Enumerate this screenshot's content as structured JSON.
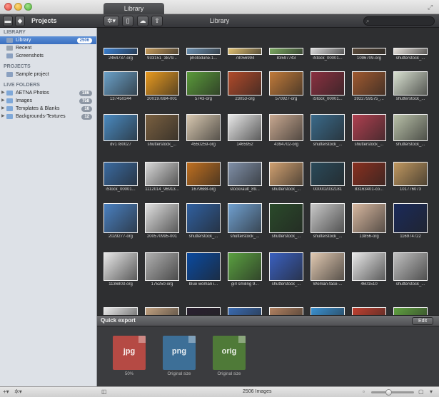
{
  "window": {
    "tab_title": "Library",
    "toolbar_title": "Library"
  },
  "toolbar": {
    "projects_label": "Projects",
    "search_placeholder": ""
  },
  "sidebar": {
    "library_header": "LIBRARY",
    "library_items": [
      {
        "label": "Library",
        "badge": "2506",
        "selected": true,
        "icon": "library-icon"
      },
      {
        "label": "Recent",
        "badge": "",
        "selected": false,
        "icon": "clock-icon"
      },
      {
        "label": "Screenshots",
        "badge": "",
        "selected": false,
        "icon": "screenshot-icon"
      }
    ],
    "projects_header": "PROJECTS",
    "project_items": [
      {
        "label": "Sample project",
        "icon": "project-icon"
      }
    ],
    "folders_header": "LIVE FOLDERS",
    "folder_items": [
      {
        "label": "AETNA Photos",
        "badge": "186"
      },
      {
        "label": "Images",
        "badge": "758"
      },
      {
        "label": "Templates & Blanks",
        "badge": "16"
      },
      {
        "label": "Backgrounds-Textures",
        "badge": "12"
      }
    ]
  },
  "grid": {
    "rows": [
      [
        "2464737-org",
        "933151_3879...",
        "photodune-1...",
        "78056994",
        "83597743",
        "iStock_00001...",
        "1096709-org",
        "shutterstock_..."
      ],
      [
        "137450344",
        "200197884-001",
        "5743-org",
        "23053-org",
        "570927-org",
        "iStock_00001...",
        "3922759575_...",
        "shutterstock_..."
      ],
      [
        "dv1780027",
        "shutterstock_...",
        "4550259-org",
        "1465952",
        "4394702-org",
        "shutterstock_...",
        "shutterstock_...",
        "shutterstock_..."
      ],
      [
        "iStock_00001...",
        "1112014_96913...",
        "1679688-org",
        "stockvault_89...",
        "shutterstock_...",
        "000002032181",
        "83163401-co...",
        "101776073"
      ],
      [
        "2029277-org",
        "200570995-001",
        "shutterstock_...",
        "shutterstock_...",
        "shutterstock_...",
        "shutterstock_...",
        "13856-org",
        "116974722"
      ],
      [
        "1136803-org",
        "175250-org",
        "blue woman i...",
        "girl smiling 9...",
        "shutterstock_...",
        "Woman-face-...",
        "4601510",
        "shutterstock_..."
      ],
      [
        "",
        "",
        "",
        "",
        "",
        "",
        "",
        ""
      ]
    ]
  },
  "quick_export": {
    "title": "Quick export",
    "edit_label": "Edit",
    "formats": [
      {
        "label": "jpg",
        "sub": "50%",
        "color": "#b54a44"
      },
      {
        "label": "png",
        "sub": "Original size",
        "color": "#3d6f97"
      },
      {
        "label": "orig",
        "sub": "Original size",
        "color": "#4f7a38"
      }
    ]
  },
  "status": {
    "count": "2506 Images"
  }
}
